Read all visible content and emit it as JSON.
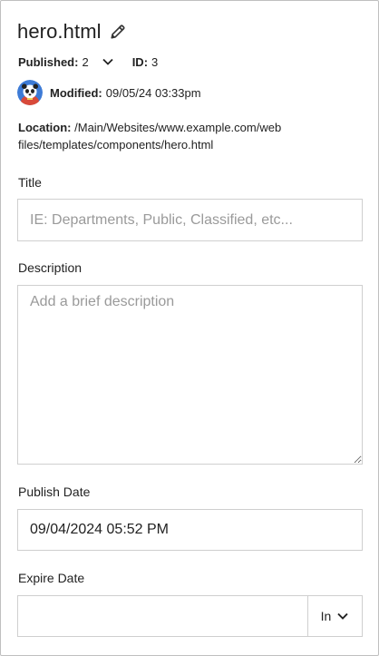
{
  "header": {
    "file_name": "hero.html",
    "edit_icon": "pencil-icon"
  },
  "meta": {
    "published_label": "Published:",
    "published_value": "2",
    "expand_icon": "chevron-down-icon",
    "id_label": "ID:",
    "id_value": "3"
  },
  "modified": {
    "avatar": "user-avatar",
    "label": "Modified:",
    "value": "09/05/24 03:33pm"
  },
  "location": {
    "label": "Location:",
    "value": "/Main/Websites/www.example.com/web files/templates/components/hero.html"
  },
  "form": {
    "title_label": "Title",
    "title_placeholder": "IE: Departments, Public, Classified, etc...",
    "title_value": "",
    "description_label": "Description",
    "description_placeholder": "Add a brief description",
    "description_value": "",
    "publish_date_label": "Publish Date",
    "publish_date_value": "09/04/2024 05:52 PM",
    "expire_date_label": "Expire Date",
    "expire_date_value": "",
    "expire_unit": "In"
  }
}
